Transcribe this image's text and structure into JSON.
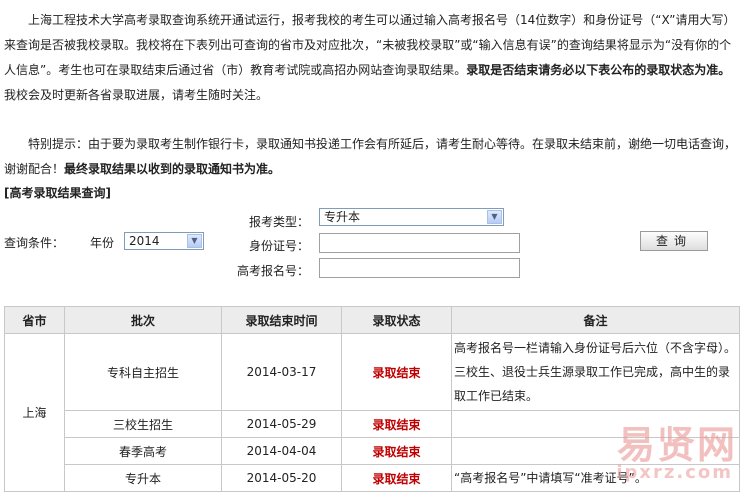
{
  "intro": {
    "p1": "上海工程技术大学高考录取查询系统开通试运行，报考我校的考生可以通过输入高考报名号（14位数字）和身份证号（“X”请用大写）来查询是否被我校录取。我校将在下表列出可查询的省市及对应批次，“未被我校录取”或“输入信息有误”的查询结果将显示为“没有你的个人信息”。考生也可在录取结束后通过省（市）教育考试院或高招办网站查询录取结果。",
    "p1_bold": "录取是否结束请务必以下表公布的录取状态为准。",
    "p1_end": "我校会及时更新各省录取进展，请考生随时关注。"
  },
  "tip": {
    "text": "特别提示：由于要为录取考生制作银行卡，录取通知书投递工作会有所延后，请考生耐心等待。在录取未结束前，谢绝一切电话查询，谢谢配合！",
    "bold": "最终录取结果以收到的录取通知书为准。"
  },
  "query": {
    "section_title": "[高考录取结果查询]",
    "condition_label": "查询条件：",
    "year_label": "年份",
    "year_value": "2014",
    "type_label": "报考类型：",
    "type_value": "专升本",
    "id_label": "身份证号：",
    "reg_label": "高考报名号：",
    "button": "查询"
  },
  "table": {
    "headers": [
      "省市",
      "批次",
      "录取结束时间",
      "录取状态",
      "备注"
    ],
    "province": "上海",
    "rows": [
      {
        "batch": "专科自主招生",
        "date": "2014-03-17",
        "status": "录取结束",
        "note": "高考报名号一栏请输入身份证号后六位（不含字母）。三校生、退役士兵生源录取工作已完成，高中生的录取工作已结束。"
      },
      {
        "batch": "三校生招生",
        "date": "2014-05-29",
        "status": "录取结束",
        "note": ""
      },
      {
        "batch": "春季高考",
        "date": "2014-04-04",
        "status": "录取结束",
        "note": ""
      },
      {
        "batch": "专升本",
        "date": "2014-05-20",
        "status": "录取结束",
        "note": "“高考报名号”中请填写“准考证号”。"
      }
    ]
  },
  "watermark": {
    "big": "易贤网",
    "small": "ipxrz.com"
  }
}
